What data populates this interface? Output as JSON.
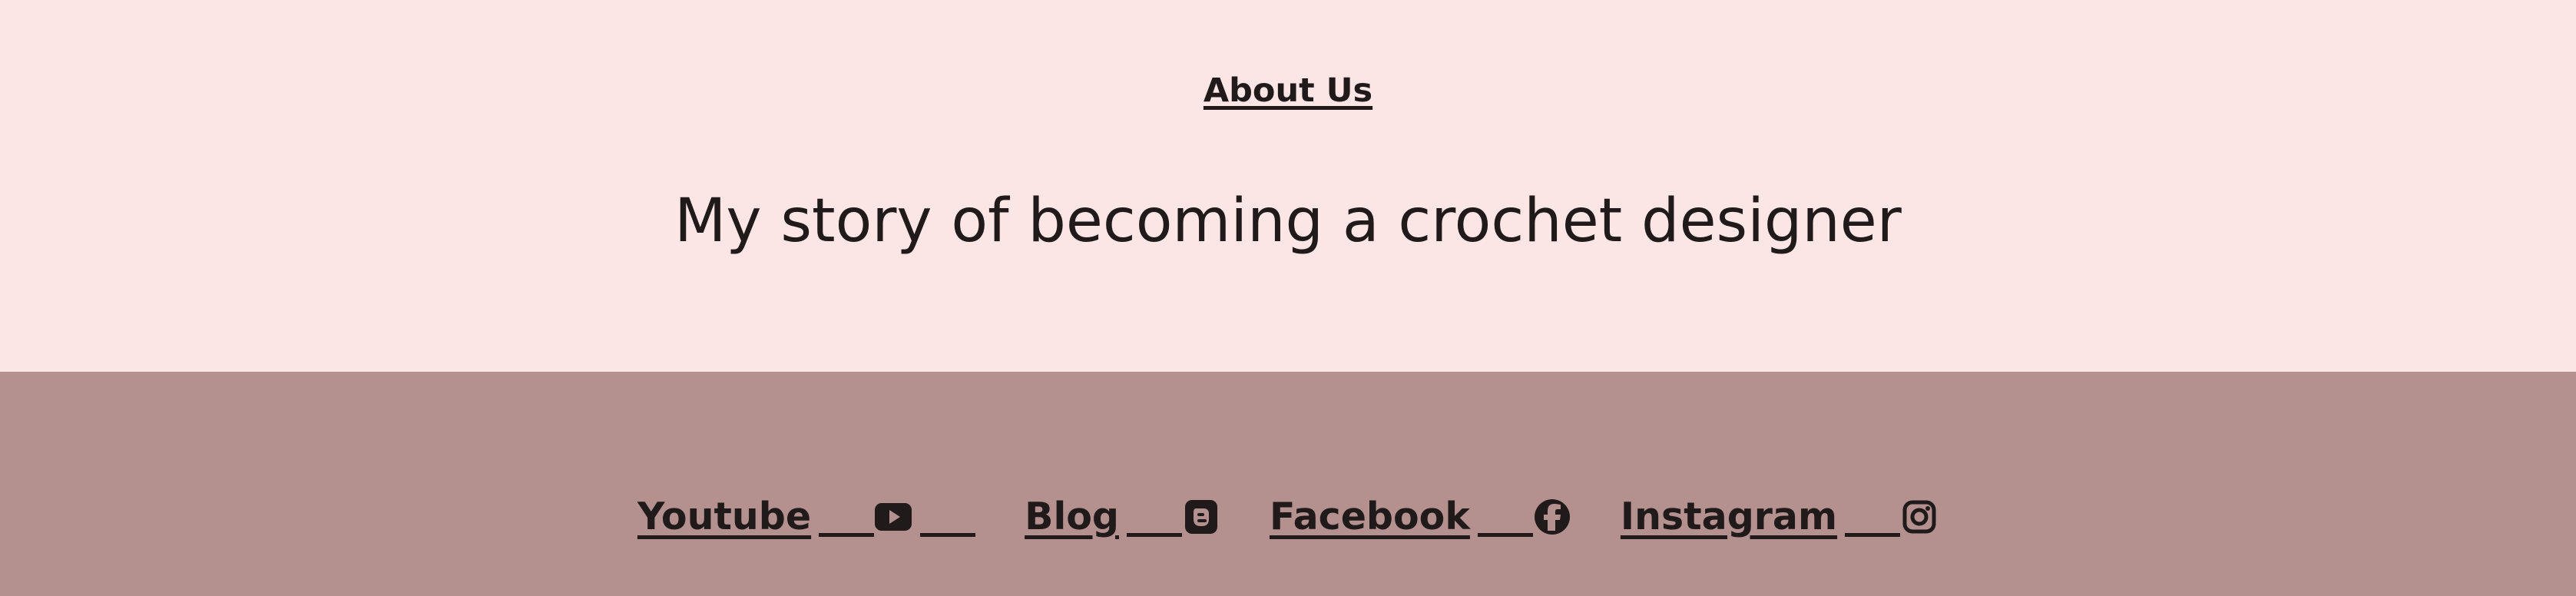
{
  "about": {
    "link_label": "About Us",
    "headline": "My story of becoming a crochet designer"
  },
  "footer": {
    "socials": [
      {
        "label": "Youtube",
        "icon": "youtube-icon"
      },
      {
        "label": "Blog",
        "icon": "blogger-icon"
      },
      {
        "label": "Facebook",
        "icon": "facebook-icon"
      },
      {
        "label": "Instagram",
        "icon": "instagram-icon"
      }
    ]
  },
  "colors": {
    "top_section_background": "#fbe6e5",
    "footer_background": "#b4918f",
    "text": "#201a1b",
    "top_rule": "#8a8585"
  }
}
